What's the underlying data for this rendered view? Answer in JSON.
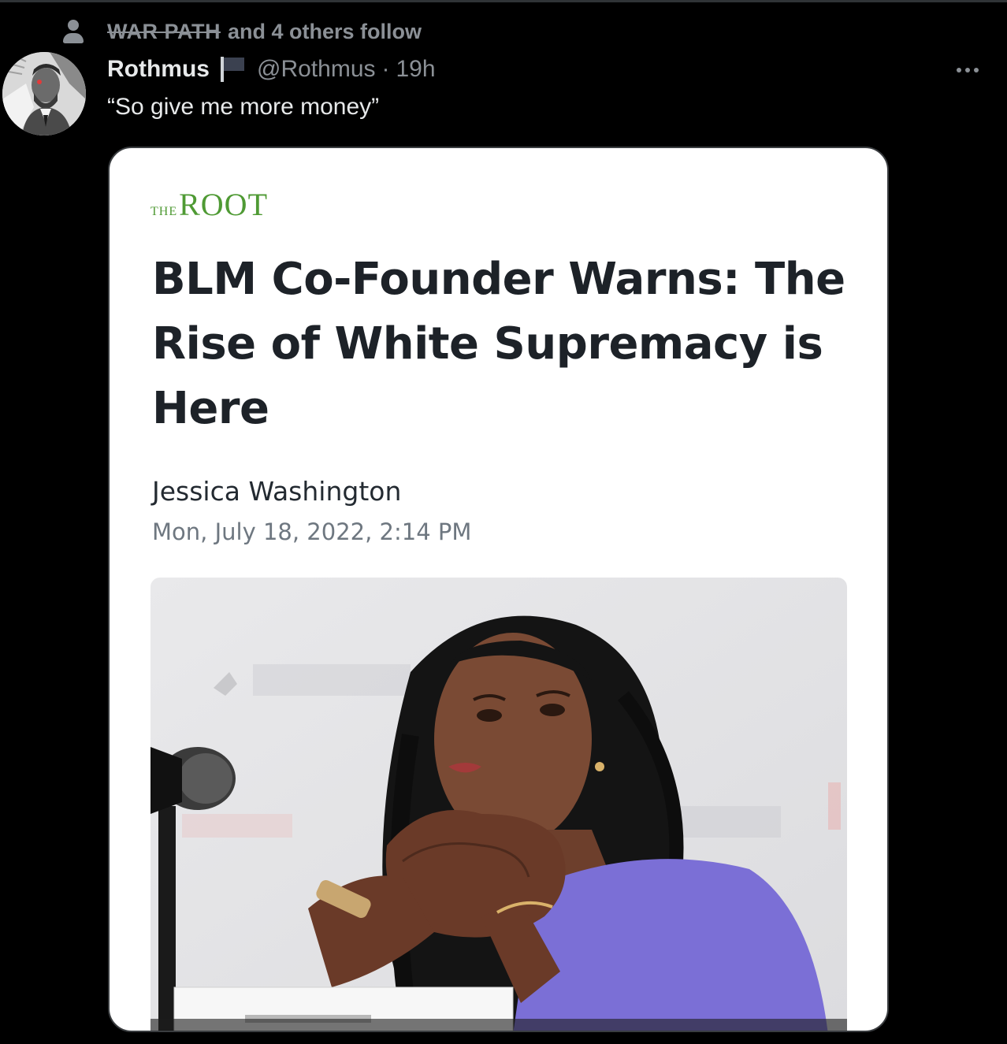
{
  "social_context": {
    "icon": "person-icon",
    "follower_name": "WAR PATH",
    "suffix": "and 4 others follow"
  },
  "tweet": {
    "display_name": "Rothmus",
    "flag_icon": "flag-icon",
    "handle": "@Rothmus",
    "separator": "·",
    "timestamp": "19h",
    "text": "“So give me more money”",
    "more_icon": "more-options-icon"
  },
  "article": {
    "publisher_prefix": "THE",
    "publisher_name": "ROOT",
    "publisher_color": "#4f9a34",
    "headline": "BLM Co-Founder Warns: The Rise of White Supremacy is Here",
    "author": "Jessica Washington",
    "date": "Mon, July 18, 2022, 2:14 PM"
  },
  "colors": {
    "background": "#000000",
    "primary_text": "#e7e9ea",
    "secondary_text": "#8b9096",
    "card_border": "#3a3d40"
  }
}
